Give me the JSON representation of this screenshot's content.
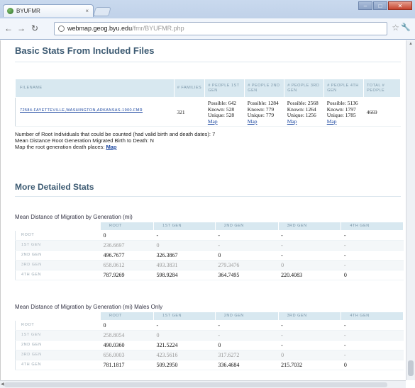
{
  "browser": {
    "tab_title": "BYUFMR",
    "tab_close": "×",
    "url_host": "webmap.geog.byu.edu",
    "url_path": "/fmr/BYUFMR.php"
  },
  "page": {
    "title": "Basic Stats From Included Files",
    "files_table": {
      "headers": [
        "FILENAME",
        "# FAMILIES",
        "# PEOPLE 1ST GEN",
        "# PEOPLE 2ND GEN",
        "# PEOPLE 3RD GEN",
        "# PEOPLE 4TH GEN",
        "TOTAL # PEOPLE"
      ],
      "row": {
        "filename": "72584-FAYETTEVILLE,WASHINGTON,ARKANSAS-1900.FMR",
        "families": "321",
        "gen1": {
          "possible": "Possible: 642",
          "known": "Known: 528",
          "unique": "Unique: 528",
          "map": "Map"
        },
        "gen2": {
          "possible": "Possible: 1284",
          "known": "Known: 779",
          "unique": "Unique: 779",
          "map": "Map"
        },
        "gen3": {
          "possible": "Possible: 2568",
          "known": "Known: 1264",
          "unique": "Unique: 1256",
          "map": "Map"
        },
        "gen4": {
          "possible": "Possible: 5136",
          "known": "Known: 1797",
          "unique": "Unique: 1785",
          "map": "Map"
        },
        "total": "4669"
      }
    },
    "info": {
      "line1": "Number of Root Individuals that could be counted (had valid birth and death dates): 7",
      "line2": "Mean Distance Root Generation Migrated Birth to Death: N",
      "line3_prefix": "Map the root generation death places:",
      "line3_link": "Map"
    },
    "more_title": "More Detailed Stats",
    "table1": {
      "caption": "Mean Distance of Migration by Generation (mi)",
      "headers": [
        "ROOT",
        "1ST GEN",
        "2ND GEN",
        "3RD GEN",
        "4TH GEN"
      ],
      "rows": [
        {
          "label": "ROOT",
          "cells": [
            "0",
            "-",
            "-",
            "-",
            "-"
          ]
        },
        {
          "label": "1ST GEN",
          "cells": [
            "236.6697",
            "0",
            "-",
            "-",
            "-"
          ]
        },
        {
          "label": "2ND GEN",
          "cells": [
            "496.7677",
            "326.3867",
            "0",
            "-",
            "-"
          ]
        },
        {
          "label": "3RD GEN",
          "cells": [
            "658.0612",
            "493.3831",
            "279.3476",
            "0",
            "-"
          ]
        },
        {
          "label": "4TH GEN",
          "cells": [
            "787.9269",
            "598.9284",
            "364.7495",
            "220.4083",
            "0"
          ]
        }
      ]
    },
    "table2": {
      "caption": "Mean Distance of Migration by Generation (mi) Males Only",
      "headers": [
        "ROOT",
        "1ST GEN",
        "2ND GEN",
        "3RD GEN",
        "4TH GEN"
      ],
      "rows": [
        {
          "label": "ROOT",
          "cells": [
            "0",
            "-",
            "-",
            "-",
            "-"
          ]
        },
        {
          "label": "1ST GEN",
          "cells": [
            "258.8054",
            "0",
            "-",
            "-",
            "-"
          ]
        },
        {
          "label": "2ND GEN",
          "cells": [
            "490.0360",
            "321.5224",
            "0",
            "-",
            "-"
          ]
        },
        {
          "label": "3RD GEN",
          "cells": [
            "656.0003",
            "423.5616",
            "317.6272",
            "0",
            "-"
          ]
        },
        {
          "label": "4TH GEN",
          "cells": [
            "781.1817",
            "509.2950",
            "336.4684",
            "215.7032",
            "0"
          ]
        }
      ]
    }
  }
}
